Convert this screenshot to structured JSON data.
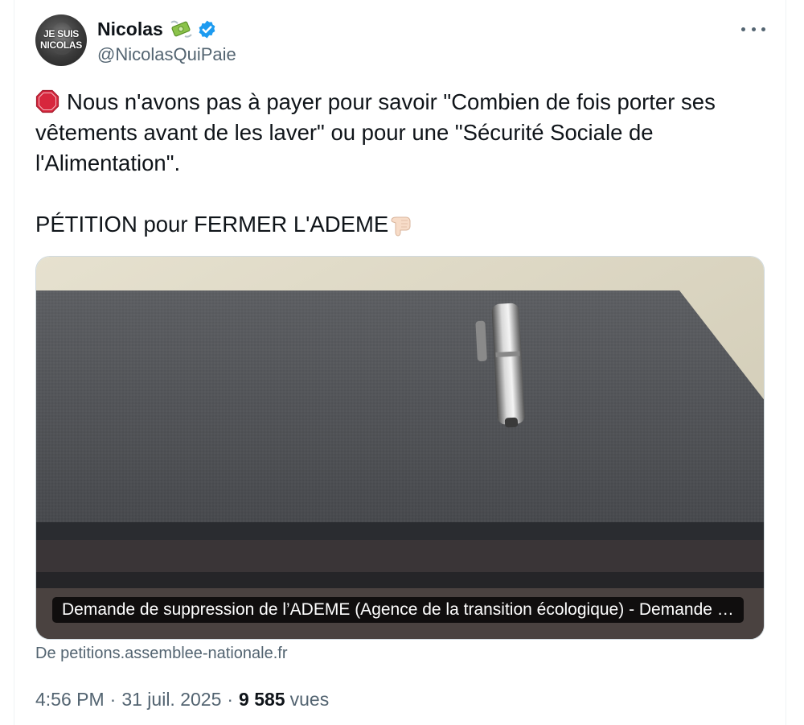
{
  "author": {
    "display_name": "Nicolas",
    "handle": "@NicolasQuiPaie",
    "avatar_text_line1": "JE SUIS",
    "avatar_text_line2": "NICOLAS"
  },
  "tweet": {
    "paragraph1": "Nous n'avons pas à payer pour savoir \"Combien de fois porter ses vêtements avant de les laver\" ou pour une \"Sécurité Sociale de l'Alimentation\".",
    "paragraph2": "PÉTITION pour FERMER L'ADEME"
  },
  "link_card": {
    "caption": "Demande de suppression de l’ADEME (Agence de la transition écologique) - Demande …",
    "source": "De petitions.assemblee-nationale.fr"
  },
  "meta": {
    "time": "4:56 PM",
    "date": "31 juil. 2025",
    "separator": "·",
    "views_count": "9 585",
    "views_label": "vues"
  },
  "icons": {
    "money": "money-with-wings-icon",
    "verified": "verified-badge-icon",
    "more": "more-options-icon",
    "stop": "stop-sign-icon",
    "pointing": "pointing-down-icon"
  },
  "colors": {
    "text_primary": "#0f1419",
    "text_secondary": "#536471",
    "verified_blue": "#1d9bf0",
    "stop_red": "#d7263d"
  }
}
